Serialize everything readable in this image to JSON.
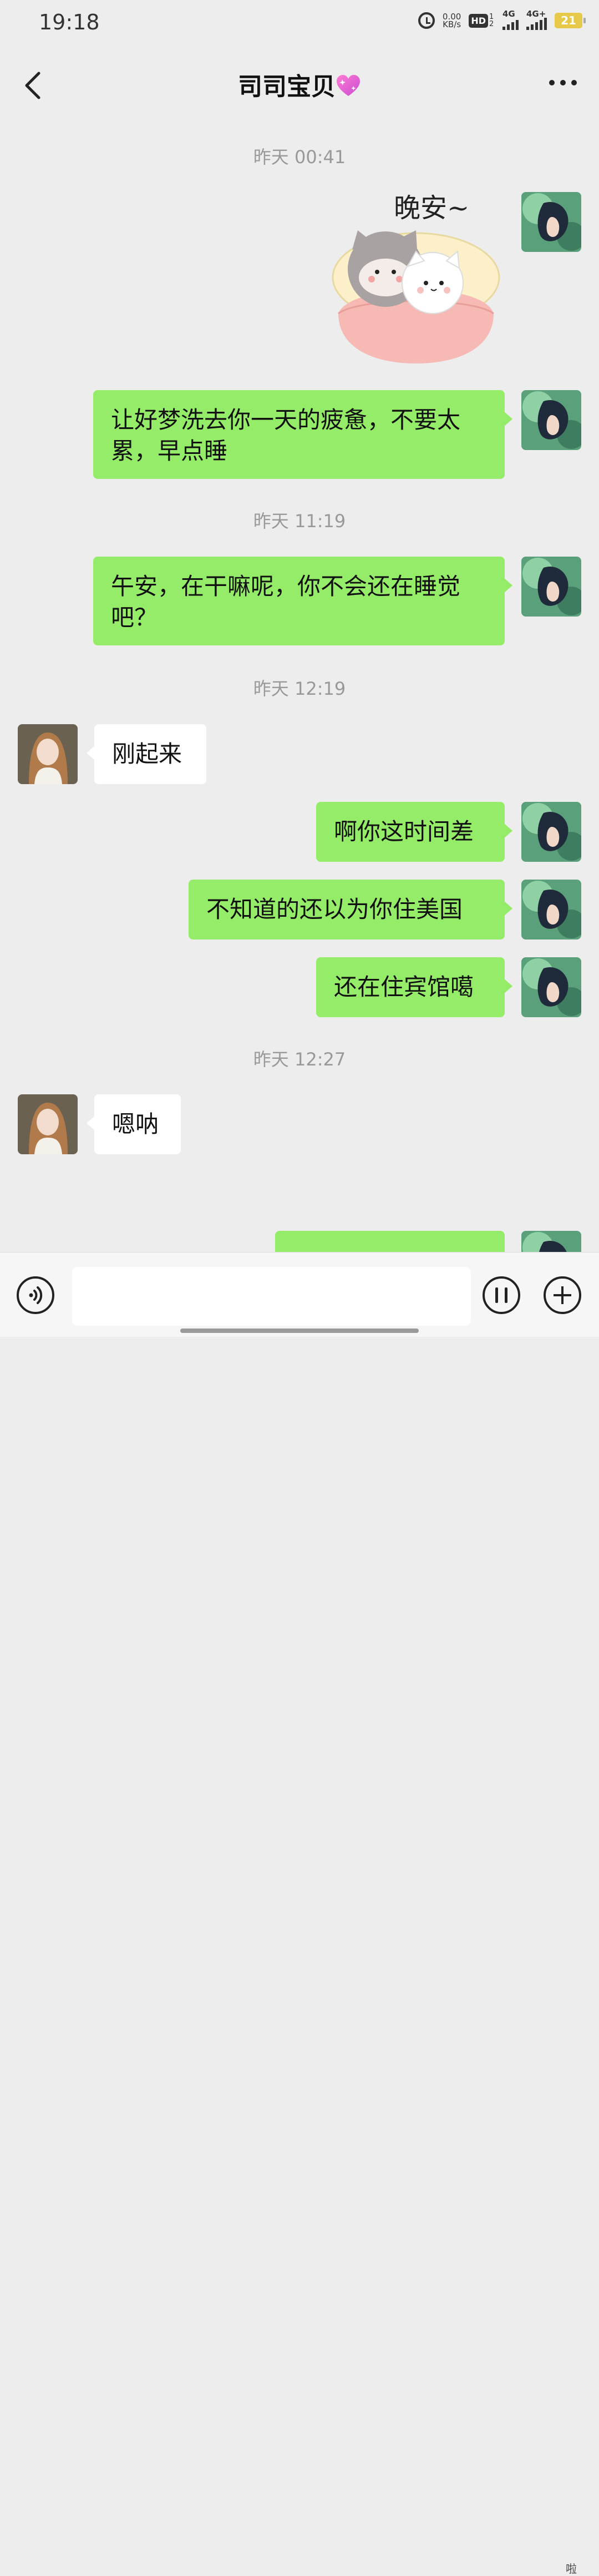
{
  "status_bar": {
    "time": "19:18",
    "net_speed_value": "0.00",
    "net_speed_unit": "KB/s",
    "hd_label": "HD",
    "hd_sub": "1 2",
    "signal1_label": "4G",
    "signal2_label": "4G+",
    "battery_level": "21",
    "battery_color": "#e7c94a"
  },
  "header": {
    "title": "司司宝贝",
    "back_icon": "chevron-left-icon",
    "more_icon": "more-dots-icon",
    "title_emoji": "sparkling-heart-icon"
  },
  "colors": {
    "background": "#ededed",
    "my_bubble": "#95ec69",
    "their_bubble": "#ffffff"
  },
  "messages": {
    "ts1": "昨天 00:41",
    "sticker_text": "晚安~",
    "m1": "让好梦洗去你一天的疲惫，不要太累，早点睡",
    "ts2": "昨天 11:19",
    "m2": "午安，在干嘛呢，你不会还在睡觉吧？",
    "ts3": "昨天 12:19",
    "m3": "刚起来",
    "m4": "啊你这时间差",
    "m5": "不知道的还以为你住美国",
    "m6": "还在住宾馆噶",
    "ts4": "昨天 12:27",
    "m7": "嗯呐"
  },
  "input_bar": {
    "voice_icon": "voice-icon",
    "emoji_icon": "emoji-icon",
    "plus_icon": "plus-icon",
    "input_value": "",
    "watermark": "啦"
  }
}
